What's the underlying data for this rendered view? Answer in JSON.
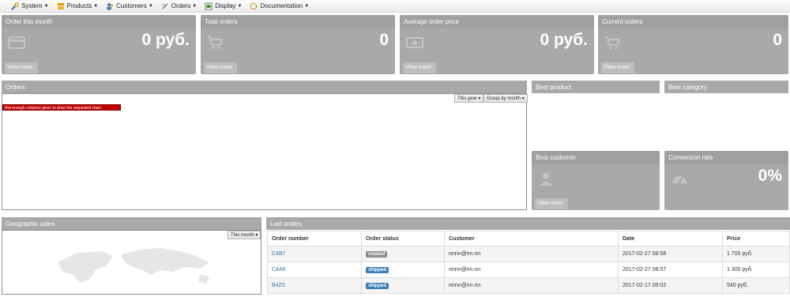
{
  "menu": [
    {
      "label": "System",
      "icon": "wrench-icon",
      "color": "#2f6cb0"
    },
    {
      "label": "Products",
      "icon": "products-icon",
      "color": "#e59a00"
    },
    {
      "label": "Customers",
      "icon": "customers-icon",
      "color": "#3a7bbf"
    },
    {
      "label": "Orders",
      "icon": "orders-icon",
      "color": "#7a8aa0"
    },
    {
      "label": "Display",
      "icon": "display-icon",
      "color": "#4a8a3a"
    },
    {
      "label": "Documentation",
      "icon": "documentation-icon",
      "color": "#d08a00"
    }
  ],
  "tiles": {
    "month": {
      "title": "Order this month",
      "value": "0 руб.",
      "link": "View more"
    },
    "total": {
      "title": "Total orders",
      "value": "0",
      "link": "View more"
    },
    "avg": {
      "title": "Average order price",
      "value": "0 руб.",
      "link": "View more"
    },
    "current": {
      "title": "Current orders",
      "value": "0",
      "link": "View more"
    }
  },
  "orders_panel": {
    "title": "Orders",
    "period": "This year",
    "group": "Group by month",
    "error": "Not enough columns given to draw the requested chart."
  },
  "best_product": {
    "title": "Best product"
  },
  "best_category": {
    "title": "Best category"
  },
  "best_customer": {
    "title": "Best customer",
    "link": "View more"
  },
  "conversion": {
    "title": "Conversion rate",
    "value": "0%"
  },
  "geo": {
    "title": "Geographic sales",
    "period": "This month"
  },
  "last_orders": {
    "title": "Last orders",
    "columns": [
      "Order number",
      "Order status",
      "Customer",
      "Date",
      "Price"
    ],
    "rows": [
      {
        "number": "C4B7",
        "status": "created",
        "status_color": "#8a8a8a",
        "customer": "nnnn@nn.nn",
        "date": "2017-02-27 08:58",
        "price": "1 700 руб."
      },
      {
        "number": "C4A6",
        "status": "shipped",
        "status_color": "#3a7fb5",
        "customer": "nnnn@nn.nn",
        "date": "2017-02-27 08:57",
        "price": "1 300 руб."
      },
      {
        "number": "B4Z5",
        "status": "shipped",
        "status_color": "#3a7fb5",
        "customer": "nnnn@nn.nn",
        "date": "2017-02-17 09:02",
        "price": "540 руб."
      }
    ]
  }
}
